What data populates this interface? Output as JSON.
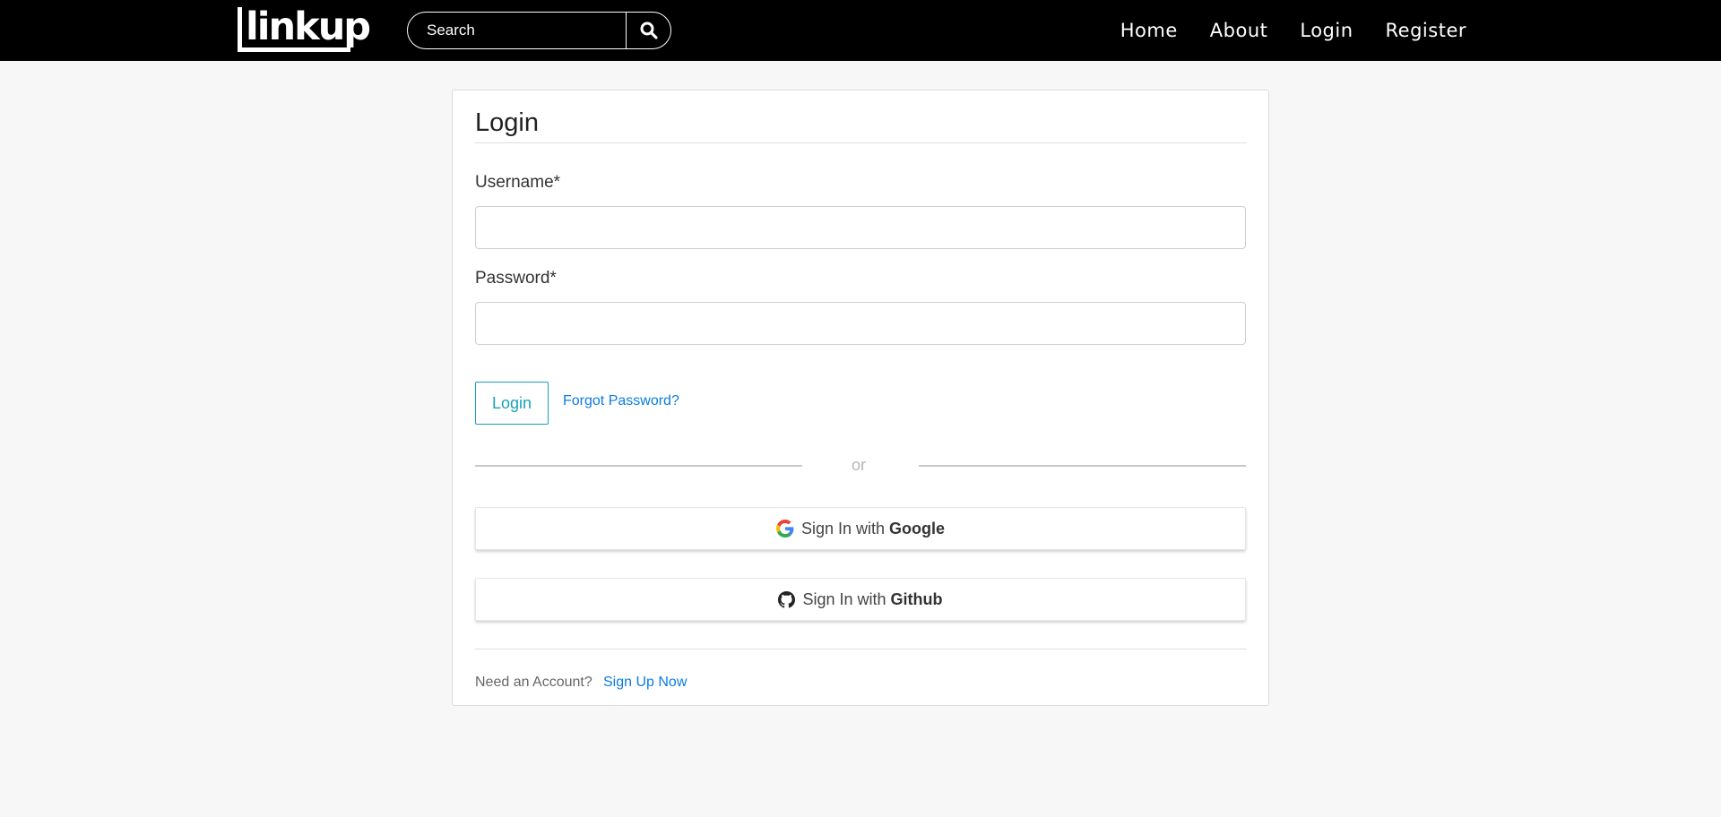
{
  "navbar": {
    "logo_text": "linkup",
    "search": {
      "placeholder": "Search",
      "value": ""
    },
    "links": [
      "Home",
      "About",
      "Login",
      "Register"
    ]
  },
  "login_form": {
    "title": "Login",
    "username_label": "Username*",
    "username_value": "",
    "password_label": "Password*",
    "password_value": "",
    "login_button": "Login",
    "forgot_link": "Forgot Password?",
    "divider_text": "or",
    "google": {
      "prefix": "Sign In with ",
      "provider": "Google"
    },
    "github": {
      "prefix": "Sign In with ",
      "provider": "Github"
    },
    "need_account": "Need an Account?",
    "signup_link": "Sign Up Now"
  },
  "colors": {
    "navbar_bg": "#000000",
    "page_bg": "#f7f7f7",
    "accent_teal": "#17a2b8",
    "link_blue": "#0b7de0"
  },
  "icons": {
    "search": "search-icon",
    "google": "google-icon",
    "github": "github-icon"
  }
}
